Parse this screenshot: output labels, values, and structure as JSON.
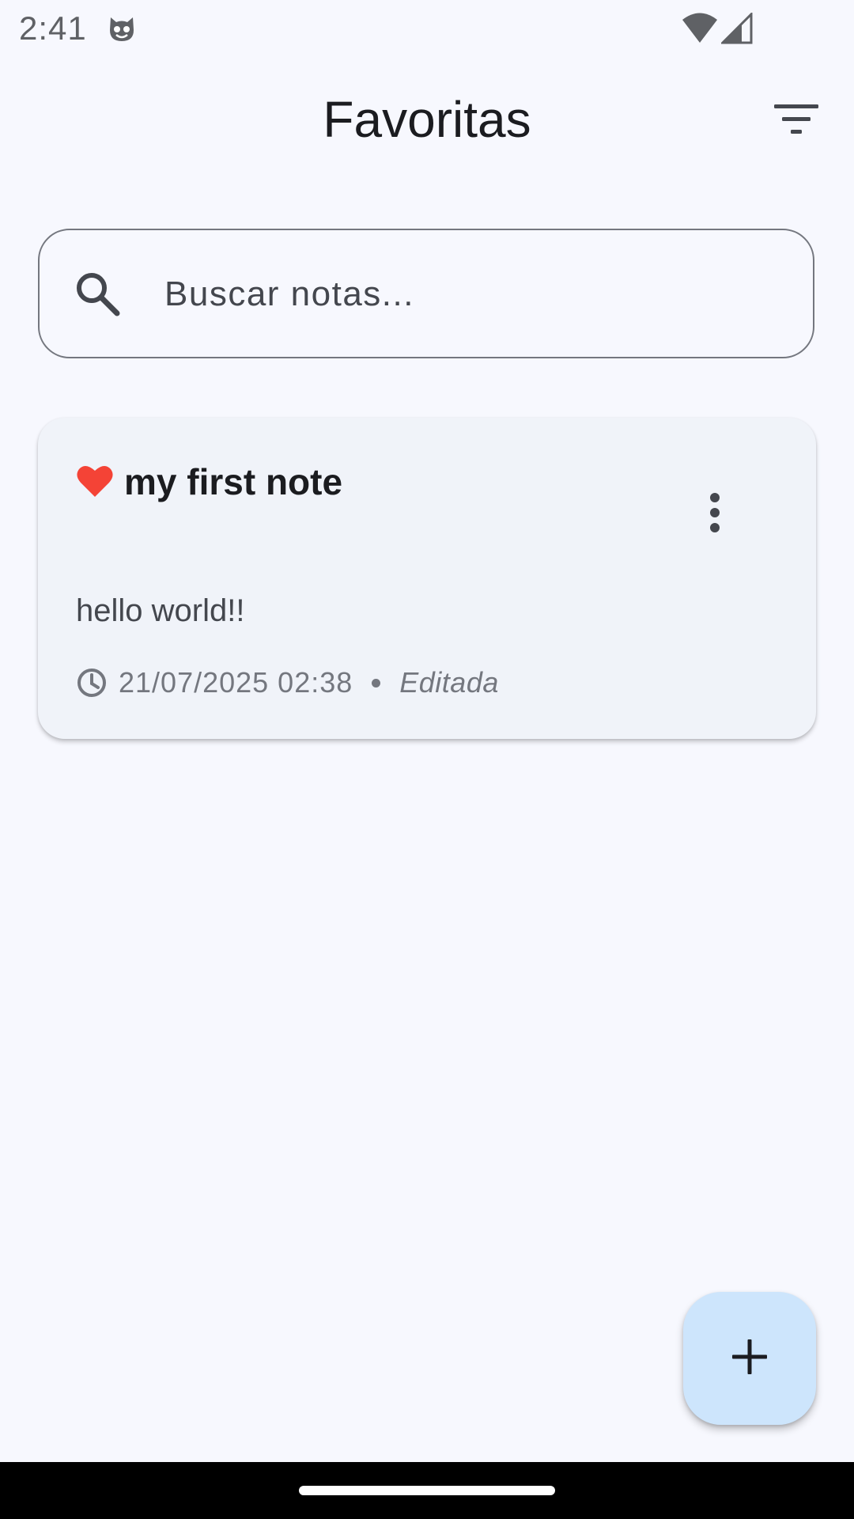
{
  "status_bar": {
    "time": "2:41",
    "app_icon": "cat-face-icon",
    "wifi_icon": "wifi-icon",
    "signal_icon": "signal-icon"
  },
  "app_bar": {
    "title": "Favoritas",
    "filter_icon": "filter-icon"
  },
  "search": {
    "placeholder": "Buscar notas...",
    "value": "",
    "icon": "search-icon"
  },
  "notes": [
    {
      "title": "my first note",
      "body": "hello world!!",
      "date": "21/07/2025 02:38",
      "status": "Editada",
      "favorite": true,
      "favorite_icon": "heart-icon",
      "menu_icon": "more-vert-icon",
      "time_icon": "clock-icon"
    }
  ],
  "fab": {
    "icon": "plus-icon"
  },
  "colors": {
    "background": "#f7f8fe",
    "card": "#f0f3f9",
    "favorite": "#f44336",
    "fab": "#cde5fc",
    "text_primary": "#1b1c20",
    "text_secondary": "#74777f"
  }
}
